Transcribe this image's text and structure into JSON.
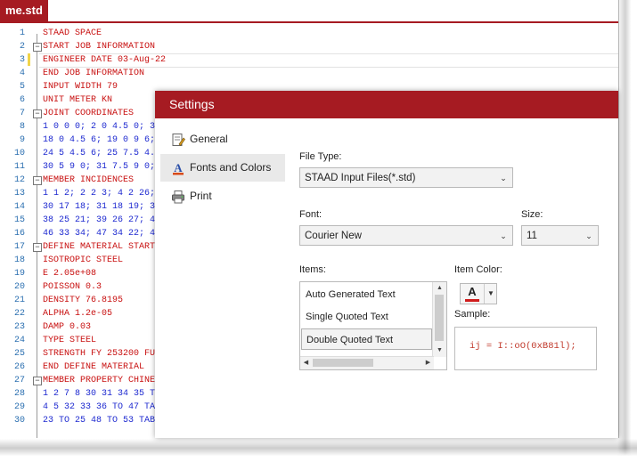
{
  "editor": {
    "file_tab": "me.std",
    "lines": [
      {
        "n": "1",
        "fold": "",
        "parts": [
          {
            "t": "STAAD SPACE",
            "c": "kw"
          }
        ]
      },
      {
        "n": "2",
        "fold": "−",
        "parts": [
          {
            "t": "START JOB INFORMATION",
            "c": "kw"
          }
        ]
      },
      {
        "n": "3",
        "fold": "",
        "parts": [
          {
            "t": "ENGINEER DATE 03-Aug-22",
            "c": "kw"
          }
        ]
      },
      {
        "n": "4",
        "fold": "",
        "parts": [
          {
            "t": "END JOB INFORMATION",
            "c": "kw"
          }
        ]
      },
      {
        "n": "5",
        "fold": "",
        "parts": [
          {
            "t": "INPUT WIDTH 79",
            "c": "kw"
          }
        ]
      },
      {
        "n": "6",
        "fold": "",
        "parts": [
          {
            "t": "UNIT METER KN",
            "c": "kw"
          }
        ]
      },
      {
        "n": "7",
        "fold": "−",
        "parts": [
          {
            "t": "JOINT COORDINATES",
            "c": "kw"
          }
        ]
      },
      {
        "n": "8",
        "fold": "",
        "parts": [
          {
            "t": "1 0 0 0; 2 0 4.5 0; 3",
            "c": "num"
          }
        ]
      },
      {
        "n": "9",
        "fold": "",
        "parts": [
          {
            "t": "18 0 4.5 6; 19 0 9 6;",
            "c": "num"
          }
        ]
      },
      {
        "n": "10",
        "fold": "",
        "parts": [
          {
            "t": "24 5 4.5 6; 25 7.5 4.",
            "c": "num"
          }
        ]
      },
      {
        "n": "11",
        "fold": "",
        "parts": [
          {
            "t": "30 5 9 0; 31 7.5 9 0;",
            "c": "num"
          }
        ]
      },
      {
        "n": "12",
        "fold": "−",
        "parts": [
          {
            "t": "MEMBER INCIDENCES",
            "c": "kw"
          }
        ]
      },
      {
        "n": "13",
        "fold": "",
        "parts": [
          {
            "t": "1 1 2; 2 2 3; 4 2 26;",
            "c": "num"
          }
        ]
      },
      {
        "n": "14",
        "fold": "",
        "parts": [
          {
            "t": "30 17 18; 31 18 19; 3",
            "c": "num"
          }
        ]
      },
      {
        "n": "15",
        "fold": "",
        "parts": [
          {
            "t": "38 25 21; 39 26 27; 4",
            "c": "num"
          }
        ]
      },
      {
        "n": "16",
        "fold": "",
        "parts": [
          {
            "t": "46 33 34; 47 34 22; 4",
            "c": "num"
          }
        ]
      },
      {
        "n": "17",
        "fold": "−",
        "parts": [
          {
            "t": "DEFINE MATERIAL START",
            "c": "kw"
          }
        ]
      },
      {
        "n": "18",
        "fold": "",
        "parts": [
          {
            "t": "ISOTROPIC STEEL",
            "c": "kw"
          }
        ]
      },
      {
        "n": "19",
        "fold": "",
        "parts": [
          {
            "t": "E ",
            "c": "kw"
          },
          {
            "t": "2.05e+08",
            "c": "kw"
          }
        ]
      },
      {
        "n": "20",
        "fold": "",
        "parts": [
          {
            "t": "POISSON ",
            "c": "kw"
          },
          {
            "t": "0.3",
            "c": "kw"
          }
        ]
      },
      {
        "n": "21",
        "fold": "",
        "parts": [
          {
            "t": "DENSITY 76.8195",
            "c": "kw"
          }
        ]
      },
      {
        "n": "22",
        "fold": "",
        "parts": [
          {
            "t": "ALPHA 1.2e-05",
            "c": "kw"
          }
        ]
      },
      {
        "n": "23",
        "fold": "",
        "parts": [
          {
            "t": "DAMP 0.03",
            "c": "kw"
          }
        ]
      },
      {
        "n": "24",
        "fold": "",
        "parts": [
          {
            "t": "TYPE STEEL",
            "c": "kw"
          }
        ]
      },
      {
        "n": "25",
        "fold": "",
        "parts": [
          {
            "t": "STRENGTH FY 253200 FU",
            "c": "kw"
          }
        ]
      },
      {
        "n": "26",
        "fold": "",
        "parts": [
          {
            "t": "END DEFINE MATERIAL",
            "c": "kw"
          }
        ]
      },
      {
        "n": "27",
        "fold": "−",
        "parts": [
          {
            "t": "MEMBER PROPERTY CHINE",
            "c": "kw"
          }
        ]
      },
      {
        "n": "28",
        "fold": "",
        "parts": [
          {
            "t": "1 2 7 8 30 31 34 35 T",
            "c": "num"
          }
        ]
      },
      {
        "n": "29",
        "fold": "",
        "parts": [
          {
            "t": "4 5 32 33 36 TO 47 TA",
            "c": "num"
          }
        ]
      },
      {
        "n": "30",
        "fold": "",
        "parts": [
          {
            "t": "23 TO 25 48 TO 53 TAB",
            "c": "num"
          }
        ]
      }
    ]
  },
  "dialog": {
    "title": "Settings",
    "nav": [
      {
        "label": "General",
        "icon": "general-settings-icon"
      },
      {
        "label": "Fonts and Colors",
        "icon": "font-color-icon",
        "selected": true
      },
      {
        "label": "Print",
        "icon": "printer-icon"
      }
    ],
    "file_type_label": "File Type:",
    "file_type_value": "STAAD Input Files(*.std)",
    "font_label": "Font:",
    "font_value": "Courier New",
    "size_label": "Size:",
    "size_value": "11",
    "items_label": "Items:",
    "items": [
      "Auto Generated Text",
      "Single Quoted Text",
      "Double Quoted Text"
    ],
    "selected_item": "Double Quoted Text",
    "item_color_label": "Item Color:",
    "item_color_glyph": "A",
    "item_color": "#d01c1c",
    "sample_label": "Sample:",
    "sample_text": "ij = I::oO(0xB81l);"
  },
  "colors": {
    "accent": "#a61b22",
    "keyword": "#c81010",
    "number": "#1e2ad0"
  }
}
